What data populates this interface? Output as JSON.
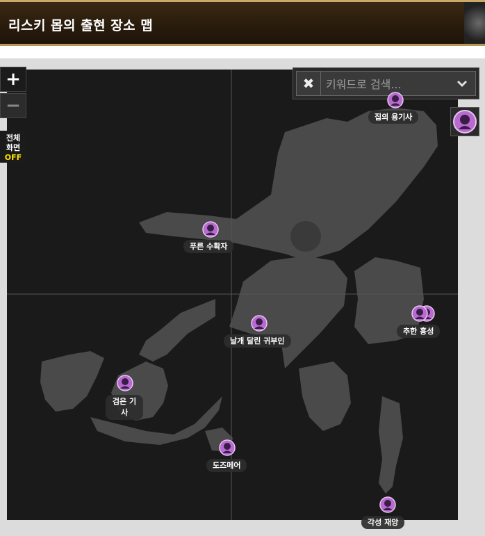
{
  "header": {
    "title": "리스키 몹의 출현 장소 맵"
  },
  "controls": {
    "zoom_in": "+",
    "zoom_out": "−",
    "fullscreen_line1": "전체",
    "fullscreen_line2": "화면",
    "fullscreen_state": "OFF"
  },
  "search": {
    "placeholder": "키워드로 검색...",
    "value": "",
    "clear_icon": "✖",
    "dropdown_icon": "⌄"
  },
  "markers": [
    {
      "label": "집의 용기사",
      "icon": "monster-avatar-icon"
    },
    {
      "label": "푸른 수확자",
      "icon": "monster-avatar-icon"
    },
    {
      "label": "날개 달린 귀부인",
      "icon": "monster-avatar-icon"
    },
    {
      "label": "추한 흉성",
      "icon": "monster-avatar-icon"
    },
    {
      "label": "검은 기사",
      "icon": "monster-avatar-icon"
    },
    {
      "label": "도즈메어",
      "icon": "monster-avatar-icon"
    },
    {
      "label": "각성 재앙",
      "icon": "monster-avatar-icon"
    }
  ],
  "colors": {
    "marker_fill": "#b86ad0",
    "map_bg": "#1a1a1a",
    "land": "#4a4a4a",
    "accent_off": "#ffe100"
  }
}
